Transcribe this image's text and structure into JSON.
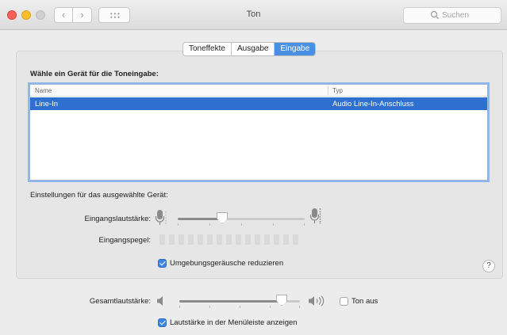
{
  "window": {
    "title": "Ton",
    "search_placeholder": "Suchen",
    "nav_back": "‹",
    "nav_forward": "›"
  },
  "tabs": [
    {
      "label": "Toneffekte",
      "active": false
    },
    {
      "label": "Ausgabe",
      "active": false
    },
    {
      "label": "Eingabe",
      "active": true
    }
  ],
  "input": {
    "heading": "Wähle ein Gerät für die Toneingabe:",
    "columns": {
      "name": "Name",
      "type": "Typ"
    },
    "devices": [
      {
        "name": "Line-In",
        "type": "Audio Line-In-Anschluss",
        "selected": true
      }
    ],
    "settings_label": "Einstellungen für das ausgewählte Gerät:",
    "volume_label": "Eingangslautstärke:",
    "volume_level": 0.35,
    "level_label": "Eingangspegel:",
    "level_segments": 15,
    "level_active": 0,
    "noise_checkbox": {
      "label": "Umgebungsgeräusche reduzieren",
      "checked": true
    },
    "help": "?"
  },
  "output": {
    "total_label": "Gesamtlautstärke:",
    "total_level": 0.85,
    "mute_checkbox": {
      "label": "Ton aus",
      "checked": false
    },
    "menubar_checkbox": {
      "label": "Lautstärke in der Menüleiste anzeigen",
      "checked": true
    }
  },
  "colors": {
    "accent": "#4a90e2",
    "selection": "#2f6fd0",
    "checkbox": "#3b87e3"
  },
  "icons": [
    "search-icon",
    "microphone-icon",
    "speaker-low-icon",
    "speaker-high-icon",
    "help-icon"
  ]
}
